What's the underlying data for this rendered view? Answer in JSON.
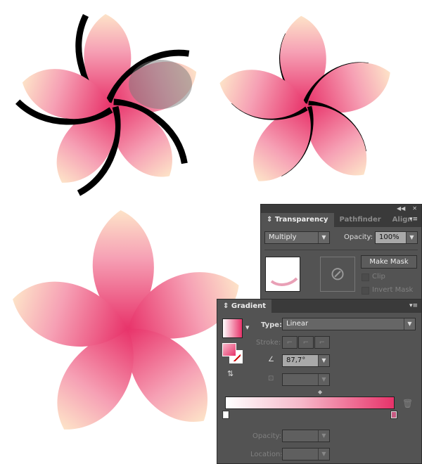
{
  "colors": {
    "petal_base": "#e8336a",
    "petal_tip": "#fde3c8",
    "panel_bg": "#535353"
  },
  "transparency": {
    "tabs": [
      {
        "label": "Transparency",
        "active": true
      },
      {
        "label": "Pathfinder"
      },
      {
        "label": "Align"
      }
    ],
    "blend_mode": "Multiply",
    "opacity_label": "Opacity:",
    "opacity_value": "100%",
    "make_mask_label": "Make Mask",
    "clip_label": "Clip",
    "invert_mask_label": "Invert Mask",
    "collapse_icon": "double-chevron-left-icon",
    "close_icon": "close-icon"
  },
  "gradient": {
    "title": "Gradient",
    "type_label": "Type:",
    "type_value": "Linear",
    "stroke_label": "Stroke:",
    "angle_value": "87,7°",
    "aspect_value": "",
    "opacity_label": "Opacity:",
    "opacity_value": "",
    "location_label": "Location:",
    "location_value": "",
    "stops": [
      {
        "color": "#ffffff",
        "location": 0
      },
      {
        "color": "#e8336a",
        "location": 100
      }
    ]
  }
}
